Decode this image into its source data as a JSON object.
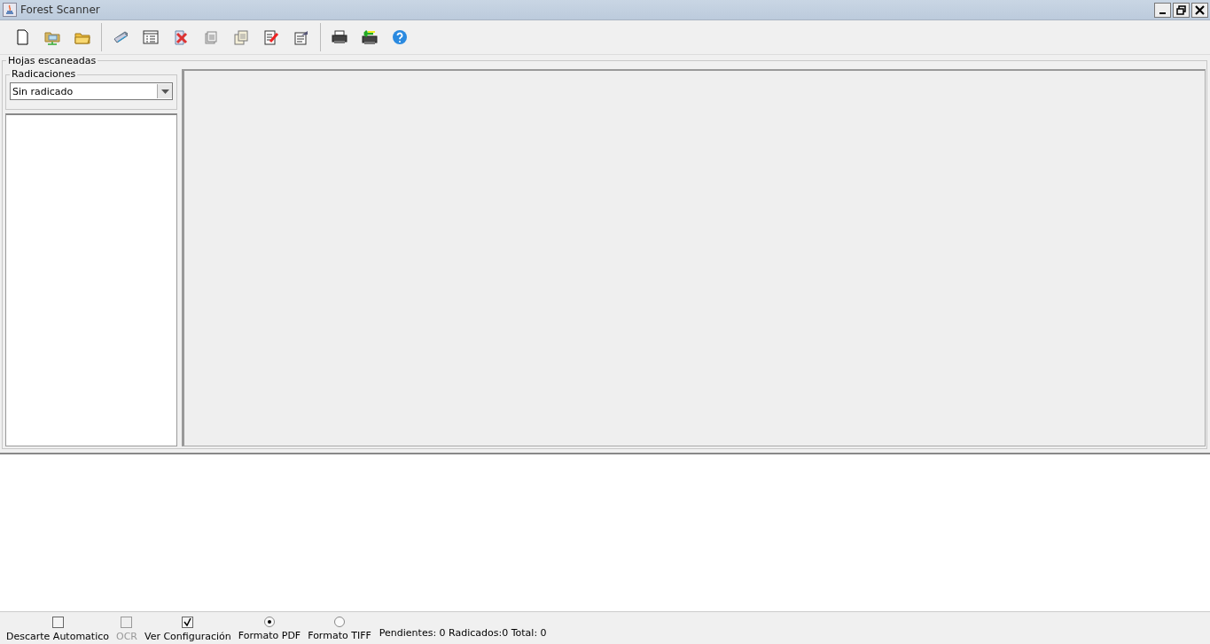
{
  "window": {
    "title": "Forest Scanner"
  },
  "scanned_sheets": {
    "title": "Hojas escaneadas",
    "filings": {
      "title": "Radicaciones",
      "value": "Sin radicado"
    }
  },
  "options": [
    {
      "kind": "checkbox",
      "label": "Descarte Automatico",
      "checked": false,
      "disabled": false
    },
    {
      "kind": "checkbox",
      "label": "OCR",
      "checked": false,
      "disabled": true
    },
    {
      "kind": "checkbox",
      "label": "Ver Configuración",
      "checked": true,
      "disabled": false
    },
    {
      "kind": "radio",
      "label": "Formato PDF",
      "selected": true,
      "disabled": false
    },
    {
      "kind": "radio",
      "label": "Formato TIFF",
      "selected": false,
      "disabled": false
    }
  ],
  "status": "Pendientes: 0 Radicados:0 Total: 0"
}
